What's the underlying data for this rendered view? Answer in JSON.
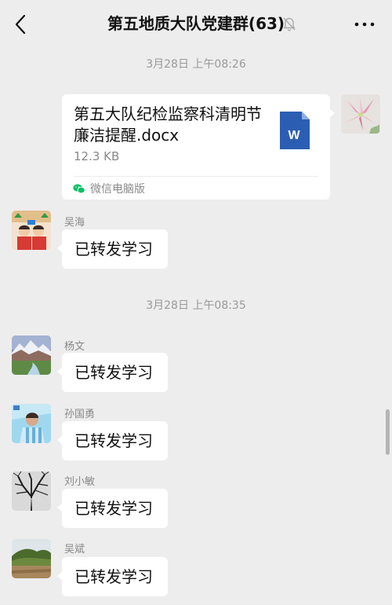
{
  "header": {
    "title": "第五地质大队党建群(63)",
    "back_icon": "chevron-left-icon",
    "mute_icon": "bell-off-icon",
    "more_icon": "more-dots-icon"
  },
  "messages": {
    "time_1": "3月28日 上午08:26",
    "file": {
      "name": "第五大队纪检监察科清明节廉洁提醒.docx",
      "size": "12.3 KB",
      "source": "微信电脑版",
      "file_icon": "word-document-icon",
      "source_icon": "wechat-icon"
    },
    "msg_1": {
      "sender": "吴海",
      "text": "已转发学习"
    },
    "time_2": "3月28日 上午08:35",
    "msg_2": {
      "sender": "杨文",
      "text": "已转发学习"
    },
    "msg_3": {
      "sender": "孙国勇",
      "text": "已转发学习"
    },
    "msg_4": {
      "sender": "刘小敏",
      "text": "已转发学习"
    },
    "msg_5": {
      "sender": "吴斌",
      "text": "已转发学习"
    }
  },
  "colors": {
    "background": "#ededed",
    "bubble": "#ffffff",
    "word_blue": "#2b5eb3",
    "wechat_green": "#07c160"
  }
}
